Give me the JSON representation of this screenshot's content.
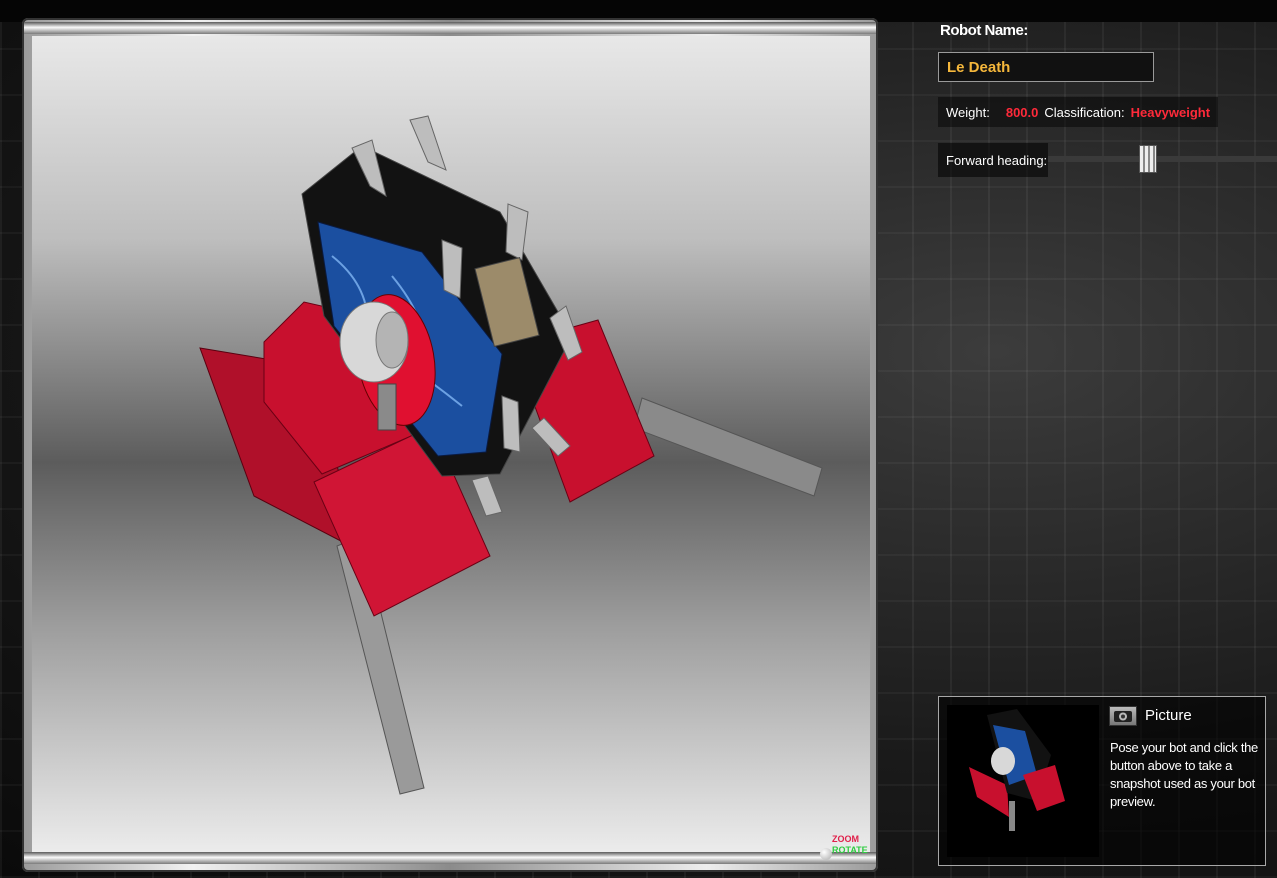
{
  "robot": {
    "name_label": "Robot Name:",
    "name_value": "Le Death",
    "weight_label": "Weight:",
    "weight_value": "800.0",
    "classification_label": "Classification:",
    "classification_value": "Heavyweight",
    "heading_label": "Forward heading:",
    "heading_level": 0.43
  },
  "viewport": {
    "zoom_label": "ZOOM",
    "rotate_label": "ROTATE"
  },
  "picture": {
    "button_label": "Picture",
    "description": "Pose your bot and click the button above to take a snapshot used as your bot preview."
  },
  "colors": {
    "accent_red": "#ff2a3a",
    "name_gold": "#f5b73b",
    "robot_red": "#c8102e",
    "robot_black": "#121212",
    "weapon_blue": "#1b4fa0"
  }
}
